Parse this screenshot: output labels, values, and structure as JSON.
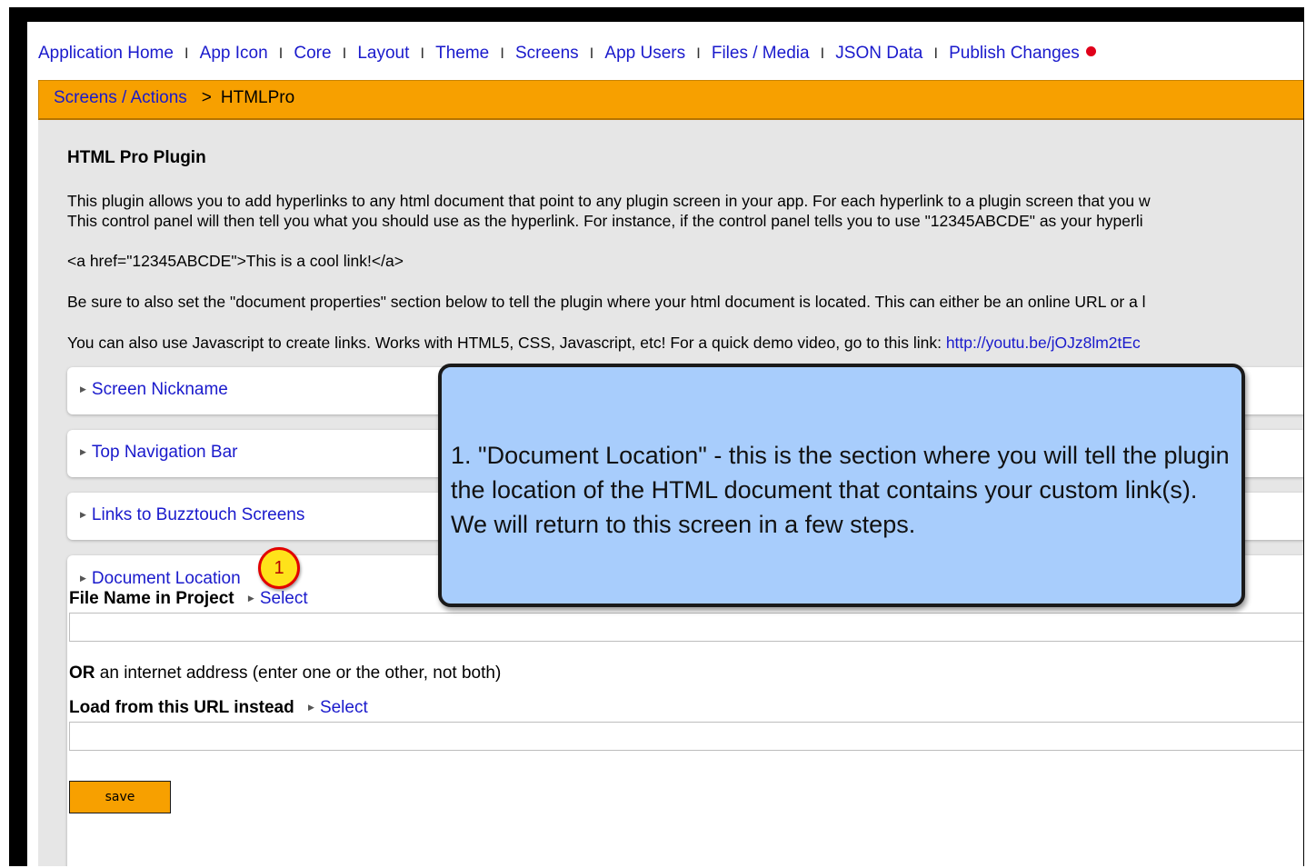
{
  "top_nav": {
    "items": [
      "Application Home",
      "App Icon",
      "Core",
      "Layout",
      "Theme",
      "Screens",
      "App Users",
      "Files / Media",
      "JSON Data",
      "Publish Changes"
    ],
    "separator": "I"
  },
  "breadcrumb": {
    "parent": "Screens / Actions",
    "separator": ">",
    "current": "HTMLPro"
  },
  "plugin": {
    "title": "HTML Pro Plugin",
    "para1_line1": "This plugin allows you to add hyperlinks to any html document that point to any plugin screen in your app. For each hyperlink to a plugin screen that you w",
    "para1_line2": "This control panel will then tell you what you should use as the hyperlink. For instance, if the control panel tells you to use \"12345ABCDE\" as your hyperli",
    "example": "<a href=\"12345ABCDE\">This is a cool link!</a>",
    "para2": "Be sure to also set the \"document properties\" section below to tell the plugin where your html document is located. This can either be an online URL or a l",
    "para3": "You can also use Javascript to create links. Works with HTML5, CSS, Javascript, etc! For a quick demo video, go to this link:",
    "video_link": "http://youtu.be/jOJz8lm2tEc"
  },
  "sections": {
    "screen_nickname": "Screen Nickname",
    "top_navigation_bar": "Top Navigation Bar",
    "links_to_buzztouch": "Links to Buzztouch Screens",
    "document_location": "Document Location"
  },
  "document_location": {
    "file_name_label": "File Name in Project",
    "select_label": "Select",
    "file_name_value": "",
    "or_bold": "OR",
    "or_rest": "an internet address (enter one or the other, not both)",
    "url_label": "Load from this URL instead",
    "url_select_label": "Select",
    "url_value": "",
    "save_label": "save"
  },
  "annotation": {
    "badge_number": "1",
    "callout_text": "1.  \"Document Location\" - this is the section where you will tell the plugin the location of the HTML document that contains your custom link(s).  We will return to this screen in a few steps."
  },
  "colors": {
    "accent_orange": "#f7a000",
    "link_blue": "#1a1acc",
    "callout_blue": "#a8cdfc",
    "badge_yellow": "#ffe21a",
    "badge_red": "#e20000"
  }
}
